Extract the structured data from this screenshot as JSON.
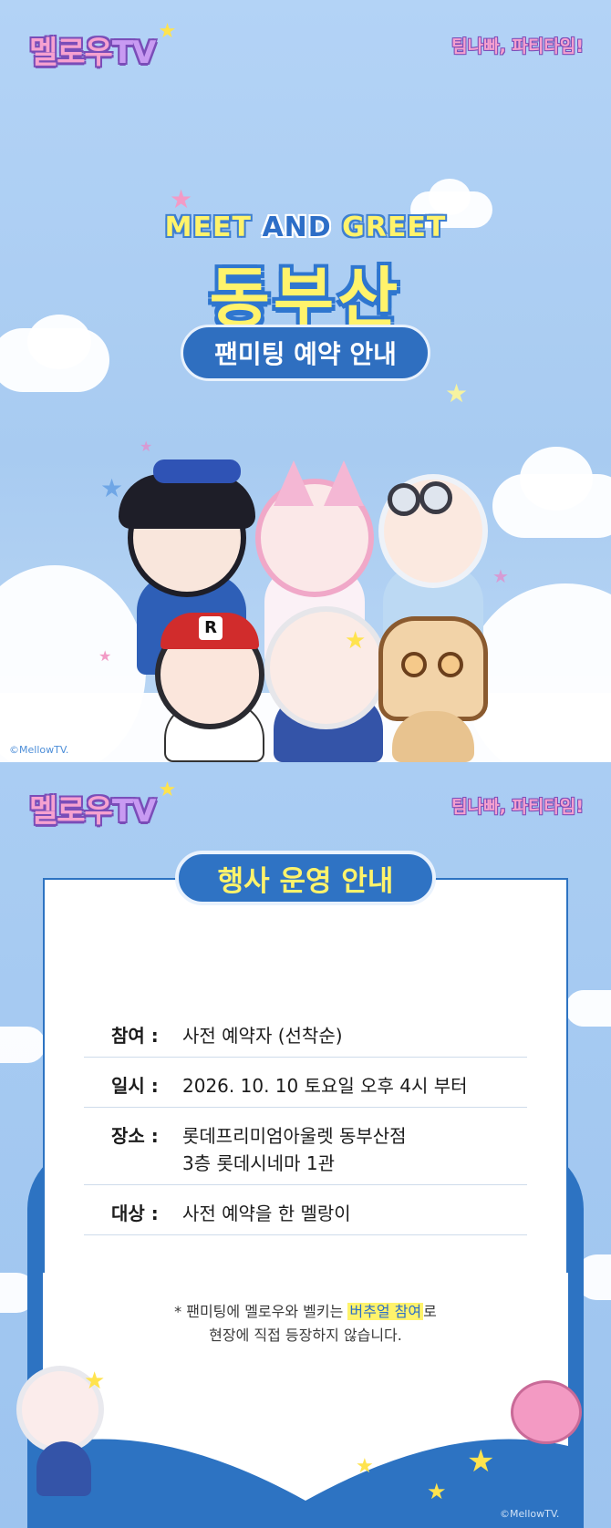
{
  "top_panel": {
    "logo_main": "멜로우",
    "logo_tv": "TV",
    "tagline": "팀나빠, 파티타임!",
    "meet_left": "MEET",
    "meet_and": "AND",
    "meet_right": "GREET",
    "city": "동부산",
    "badge": "팬미팅 예약 안내",
    "copyright": "©MellowTV."
  },
  "bottom_panel": {
    "logo_main": "멜로우",
    "logo_tv": "TV",
    "tagline": "팀나빠, 파티타임!",
    "section_title": "행사 운영 안내",
    "rows": [
      {
        "label": "참여 :",
        "value": "사전 예약자 (선착순)"
      },
      {
        "label": "일시 :",
        "value": "2026. 10. 10 토요일 오후 4시 부터"
      },
      {
        "label": "장소 :",
        "value": "롯데프리미엄아울렛 동부산점",
        "value2": "3층 롯데시네마 1관"
      },
      {
        "label": "대상 :",
        "value": "사전 예약을 한 멜랑이"
      }
    ],
    "note_prefix": "* 팬미팅에 멜로우와 벨키는 ",
    "note_highlight": "버추얼 참여",
    "note_suffix": "로",
    "note_line2": "현장에 직접 등장하지 않습니다.",
    "copyright": "©MellowTV."
  },
  "colors": {
    "sky": "#a9cdf4",
    "primary_blue": "#2f6fc0",
    "accent_yellow": "#fff36b",
    "logo_pink": "#f6a1d0",
    "logo_purple": "#7a4db8"
  }
}
